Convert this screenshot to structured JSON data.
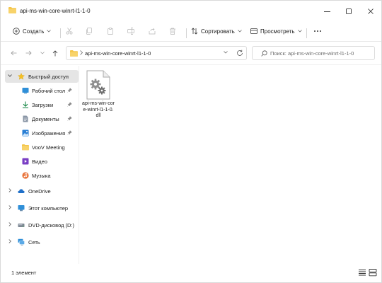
{
  "window": {
    "title": "api-ms-win-core-winrt-l1-1-0",
    "controls": [
      "minimize",
      "maximize",
      "close"
    ]
  },
  "toolbar": {
    "new_label": "Создать",
    "sort_label": "Сортировать",
    "view_label": "Просмотреть",
    "icons": [
      "cut-icon",
      "copy-icon",
      "paste-icon",
      "rename-icon",
      "share-icon",
      "delete-icon"
    ]
  },
  "address": {
    "path": "api-ms-win-core-winrt-l1-1-0"
  },
  "search": {
    "placeholder": "Поиск: api-ms-win-core-winrt-l1-1-0"
  },
  "sidebar": {
    "quick_access": "Быстрый доступ",
    "items": [
      {
        "label": "Рабочий стол",
        "pinned": true
      },
      {
        "label": "Загрузки",
        "pinned": true
      },
      {
        "label": "Документы",
        "pinned": true
      },
      {
        "label": "Изображения",
        "pinned": true
      },
      {
        "label": "VooV Meeting",
        "pinned": false
      },
      {
        "label": "Видео",
        "pinned": false
      },
      {
        "label": "Музыка",
        "pinned": false
      }
    ],
    "roots": [
      {
        "label": "OneDrive"
      },
      {
        "label": "Этот компьютер"
      },
      {
        "label": "DVD-дисковод (D:)"
      },
      {
        "label": "Сеть"
      }
    ]
  },
  "files": [
    {
      "name": "api-ms-win-core-winrt-l1-1-0.dll",
      "icon": "dll-file-icon"
    }
  ],
  "status": {
    "count_text": "1 элемент"
  },
  "colors": {
    "folder": "#f4c54a",
    "accent": "#0067c0",
    "selected_bg": "#e5e5e5"
  }
}
